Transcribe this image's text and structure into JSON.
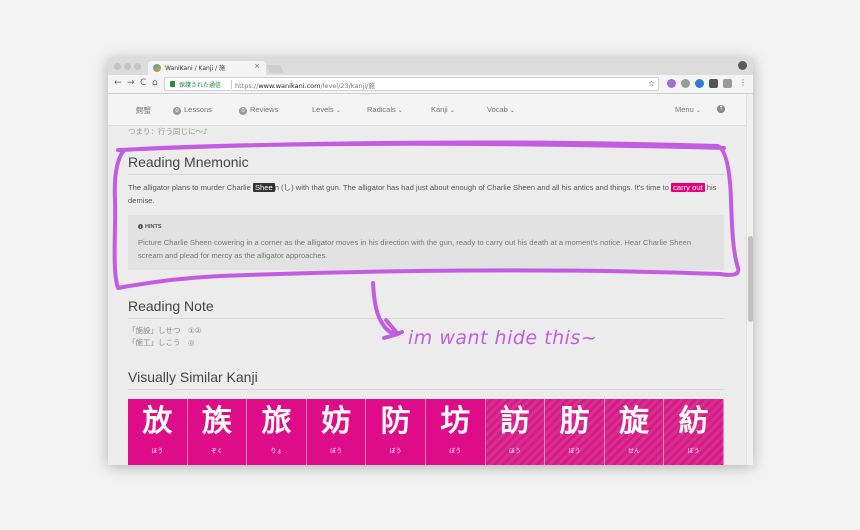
{
  "browser": {
    "tab_title": "WaniKani / Kanji / 施",
    "tab_close": "×",
    "secure_label": "保護された通信",
    "url_prefix": "https://",
    "url_host": "www.wanikani.com",
    "url_path": "/level/23/kanji/施",
    "star": "☆",
    "menu": "⋮",
    "back": "←",
    "forward": "→",
    "reload": "C",
    "home": "⌂",
    "extension_colors": [
      "#a56bd6",
      "#9a9a9a",
      "#2e7bd6",
      "#555555",
      "#9a9a9a"
    ]
  },
  "nav": {
    "logo": "鰐蟹",
    "lessons_label": "Lessons",
    "lessons_count": "0",
    "reviews_label": "Reviews",
    "reviews_count": "0",
    "levels": "Levels",
    "radicals": "Radicals",
    "kanji": "Kanji",
    "vocab": "Vocab",
    "menu": "Menu",
    "caret": "⌄",
    "help": "↑"
  },
  "prev_line": "つまり：行う同じに～♪",
  "reading_mnemonic": {
    "title": "Reading Mnemonic",
    "text_1": "The alligator plans to murder Charlie ",
    "radical_highlight": "Shee",
    "text_2": "n (し) with that gun. The alligator has had just about enough of Charlie Sheen and all his antics and things. It's time to ",
    "reading_highlight": "carry out",
    "text_3": " his demise.",
    "hints_label": "HINTS",
    "hints_text": "Picture Charlie Sheen cowering in a corner as the alligator moves in his direction with the gun, ready to carry out his death at a moment's notice. Hear Charlie Sheen scream and plead for mercy as the alligator approaches."
  },
  "reading_note": {
    "title": "Reading Note",
    "lines": [
      "「施設」しせつ　①②",
      "「施工」しこう　◎"
    ]
  },
  "similar_kanji": {
    "title": "Visually Similar Kanji",
    "items": [
      {
        "char": "放",
        "reading": "ほう",
        "striped": false
      },
      {
        "char": "族",
        "reading": "ぞく",
        "striped": false
      },
      {
        "char": "旅",
        "reading": "りょ",
        "striped": false
      },
      {
        "char": "妨",
        "reading": "ぼう",
        "striped": false
      },
      {
        "char": "防",
        "reading": "ぼう",
        "striped": false
      },
      {
        "char": "坊",
        "reading": "ぼう",
        "striped": false
      },
      {
        "char": "訪",
        "reading": "ほう",
        "striped": true
      },
      {
        "char": "肪",
        "reading": "ぼう",
        "striped": true
      },
      {
        "char": "旋",
        "reading": "せん",
        "striped": true
      },
      {
        "char": "紡",
        "reading": "ぼう",
        "striped": true
      }
    ]
  },
  "annotation": {
    "text": "im want hide this~",
    "color": "#c25de2"
  }
}
